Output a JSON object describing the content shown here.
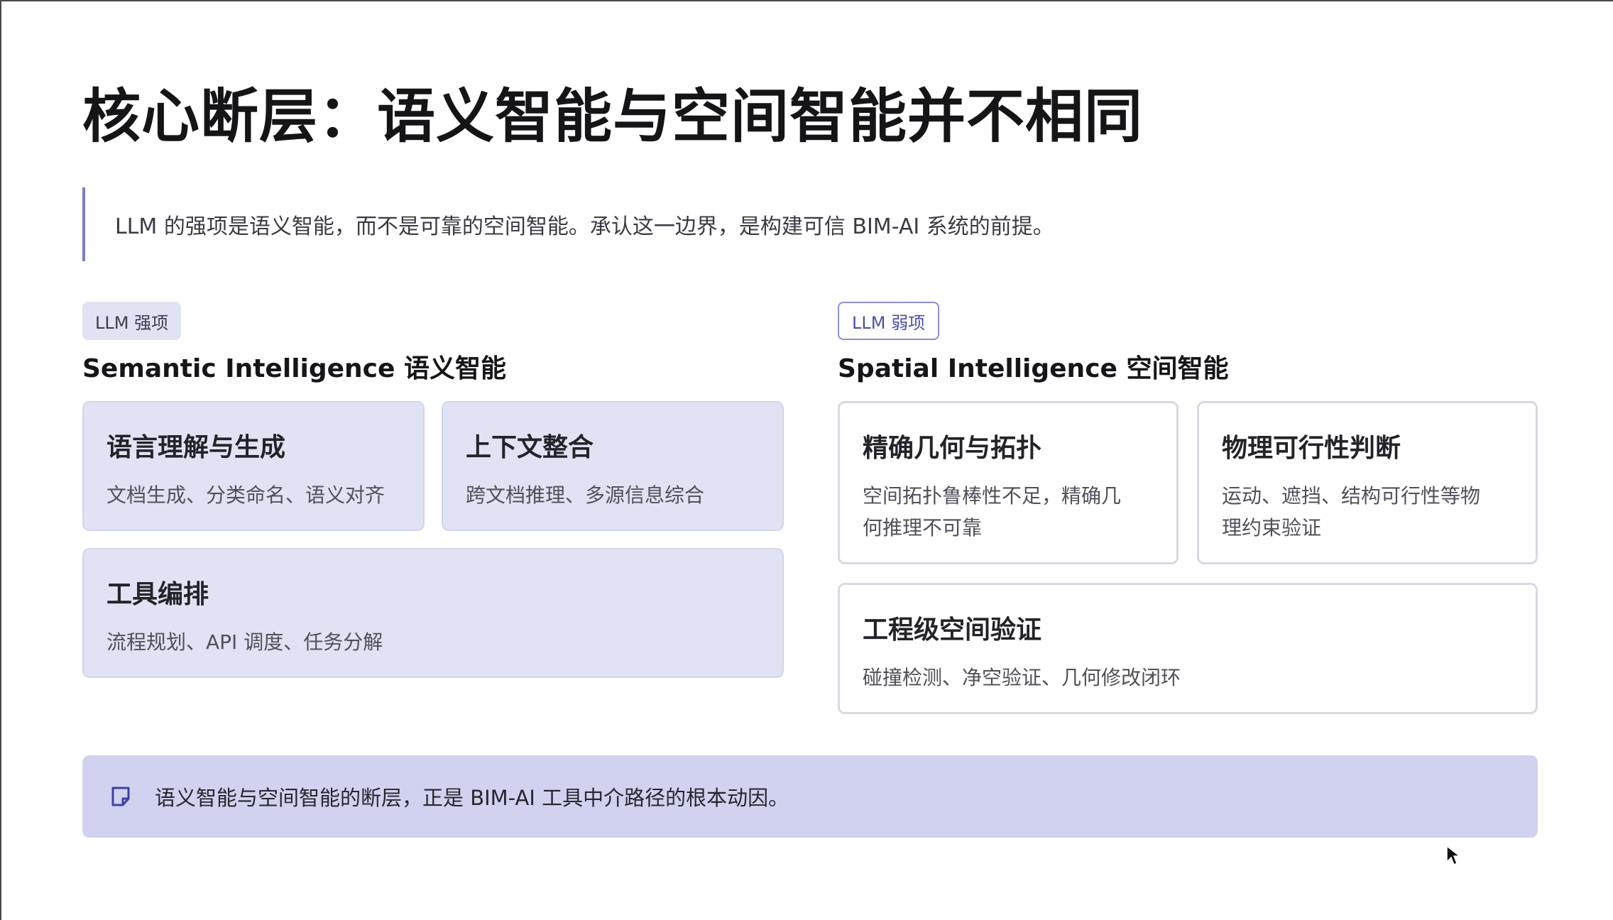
{
  "slide": {
    "title": "核心断层：语义智能与空间智能并不相同",
    "quote": "LLM 的强项是语义智能，而不是可靠的空间智能。承认这一边界，是构建可信 BIM-AI 系统的前提。"
  },
  "left": {
    "badge": "LLM 强项",
    "heading": "Semantic Intelligence 语义智能",
    "cards": [
      {
        "title": "语言理解与生成",
        "desc": "文档生成、分类命名、语义对齐"
      },
      {
        "title": "上下文整合",
        "desc": "跨文档推理、多源信息综合"
      },
      {
        "title": "工具编排",
        "desc": "流程规划、API 调度、任务分解"
      }
    ]
  },
  "right": {
    "badge": "LLM 弱项",
    "heading": "Spatial Intelligence 空间智能",
    "cards": [
      {
        "title": "精确几何与拓扑",
        "desc_lines": [
          "空间拓扑鲁棒性不足，精确几",
          "何推理不可靠"
        ]
      },
      {
        "title": "物理可行性判断",
        "desc_lines": [
          "运动、遮挡、结构可行性等物",
          "理约束验证"
        ]
      },
      {
        "title": "工程级空间验证",
        "desc_lines": [
          "碰撞检测、净空验证、几何修改闭环"
        ]
      }
    ]
  },
  "footer": {
    "icon": "note-icon",
    "text": "语义智能与空间智能的断层，正是 BIM-AI 工具中介路径的根本动因。"
  },
  "colors": {
    "accent": "#7b7fc4",
    "semantic_card": "#e1e2f3",
    "footer_bg": "#d0d2ef",
    "weak_badge_text": "#4a50a8"
  }
}
